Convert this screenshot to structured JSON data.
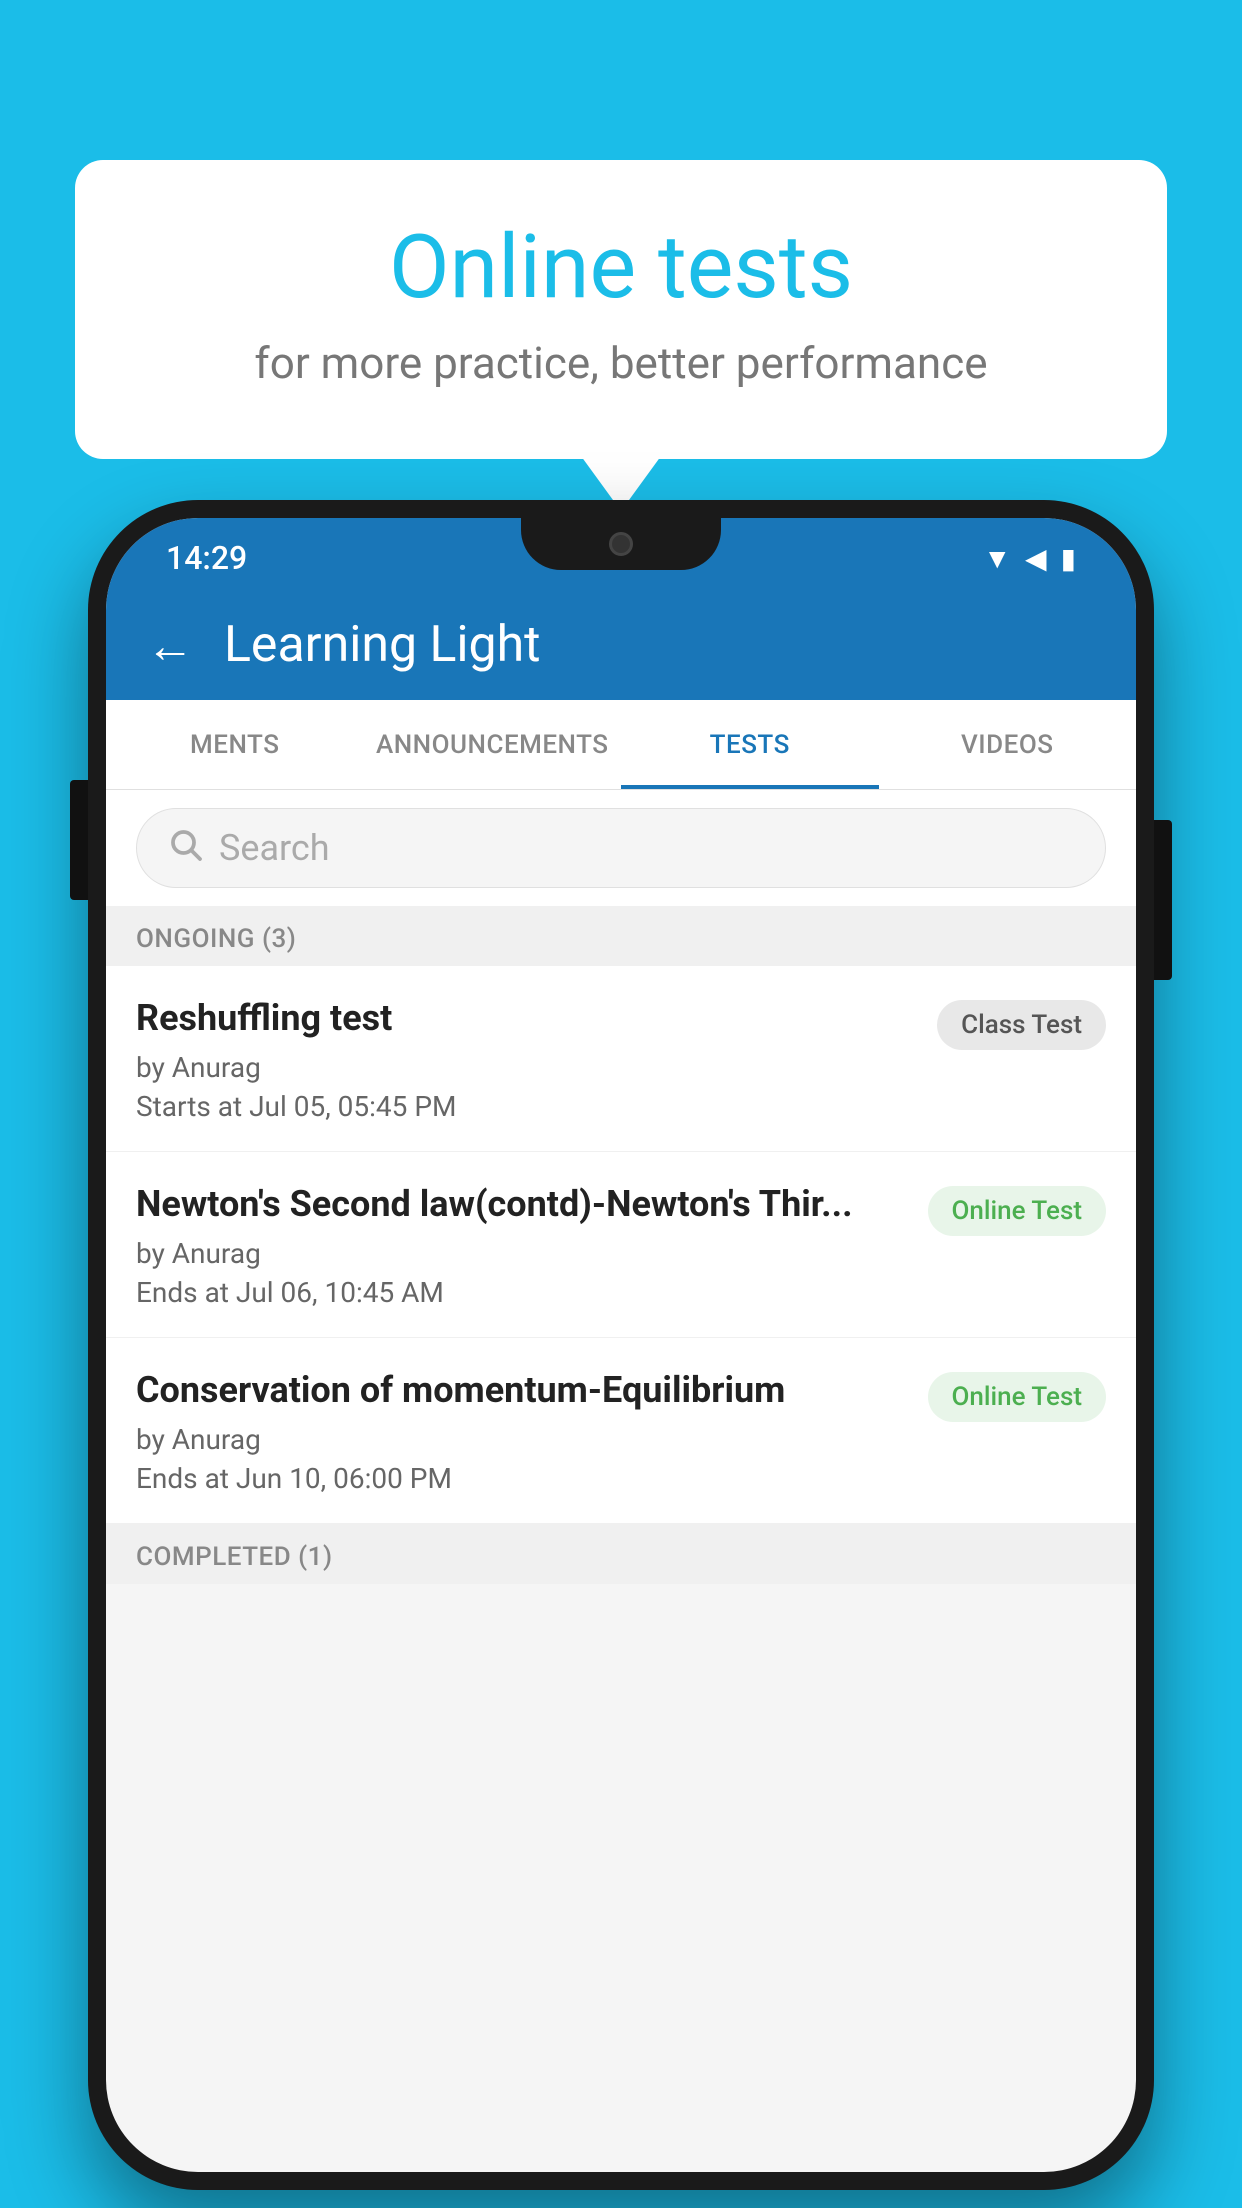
{
  "background_color": "#1BBDE8",
  "bubble": {
    "title": "Online tests",
    "subtitle": "for more practice, better performance"
  },
  "phone": {
    "status_bar": {
      "time": "14:29",
      "icons": [
        "wifi",
        "signal",
        "battery"
      ]
    },
    "header": {
      "back_label": "←",
      "title": "Learning Light"
    },
    "tabs": [
      {
        "label": "MENTS",
        "active": false
      },
      {
        "label": "ANNOUNCEMENTS",
        "active": false
      },
      {
        "label": "TESTS",
        "active": true
      },
      {
        "label": "VIDEOS",
        "active": false
      }
    ],
    "search": {
      "placeholder": "Search"
    },
    "sections": [
      {
        "title": "ONGOING (3)",
        "items": [
          {
            "name": "Reshuffling test",
            "author": "by Anurag",
            "time": "Starts at  Jul 05, 05:45 PM",
            "badge": "Class Test",
            "badge_type": "class"
          },
          {
            "name": "Newton's Second law(contd)-Newton's Thir...",
            "author": "by Anurag",
            "time": "Ends at  Jul 06, 10:45 AM",
            "badge": "Online Test",
            "badge_type": "online"
          },
          {
            "name": "Conservation of momentum-Equilibrium",
            "author": "by Anurag",
            "time": "Ends at  Jun 10, 06:00 PM",
            "badge": "Online Test",
            "badge_type": "online"
          }
        ]
      },
      {
        "title": "COMPLETED (1)",
        "items": []
      }
    ]
  }
}
